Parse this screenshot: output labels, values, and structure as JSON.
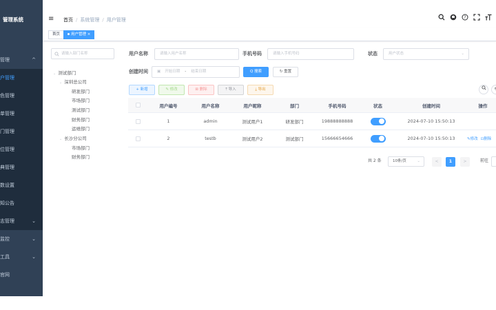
{
  "sidebar": {
    "logo": "管理系统",
    "items": [
      {
        "label": "管理",
        "chev": "^"
      },
      {
        "label": "户管理"
      },
      {
        "label": "色管理"
      },
      {
        "label": "单管理"
      },
      {
        "label": "门管理"
      },
      {
        "label": "位管理"
      },
      {
        "label": "典管理"
      },
      {
        "label": "数设置"
      },
      {
        "label": "知公告"
      },
      {
        "label": "志管理",
        "chev": "⌄"
      },
      {
        "label": "监控",
        "chev": "⌄"
      },
      {
        "label": "工具",
        "chev": "⌄"
      },
      {
        "label": "官网"
      }
    ]
  },
  "navbar": {
    "breadcrumb": [
      "首页",
      "系统管理",
      "用户管理"
    ],
    "icons": [
      "search-icon",
      "github-icon",
      "help-icon",
      "fullscreen-icon",
      "font-size-icon"
    ]
  },
  "tags": {
    "items": [
      {
        "label": "首页"
      },
      {
        "label": "用户管理 ×"
      }
    ]
  },
  "dept_tree": {
    "search_placeholder": "请输入部门名称",
    "nodes": [
      {
        "label": "测试部门",
        "arrow": "⌄"
      },
      {
        "label": "深圳总公司",
        "arrow": "⌄"
      },
      {
        "label": "研发部门"
      },
      {
        "label": "市场部门"
      },
      {
        "label": "测试部门"
      },
      {
        "label": "财务部门"
      },
      {
        "label": "运维部门"
      },
      {
        "label": "长沙分公司",
        "arrow": "⌄"
      },
      {
        "label": "市场部门"
      },
      {
        "label": "财务部门"
      }
    ]
  },
  "form": {
    "username_label": "用户名称",
    "username_placeholder": "请输入用户名称",
    "phone_label": "手机号码",
    "phone_placeholder": "请输入手机号码",
    "status_label": "状态",
    "status_placeholder": "用户状态",
    "created_label": "创建时间",
    "start_placeholder": "开始日期",
    "date_separator": "-",
    "end_placeholder": "结束日期",
    "search_btn": "Q 搜索",
    "reset_btn": "↻ 重置"
  },
  "toolbar": {
    "add": "+ 新增",
    "edit": "✎ 修改",
    "delete": "⊠ 删除",
    "import": "⤒ 导入",
    "export": "⤓ 导出"
  },
  "table": {
    "columns": [
      "用户编号",
      "用户名称",
      "用户昵称",
      "部门",
      "手机号码",
      "状态",
      "创建时间",
      "操作"
    ],
    "rows": [
      {
        "id": "1",
        "username": "admin",
        "nickname": "测试用户1",
        "dept": "研发部门",
        "phone": "19888888888",
        "status": "on",
        "created": "2024-07-10 15:50:13",
        "ops": [
          "✎修改"
        ]
      },
      {
        "id": "2",
        "username": "testb",
        "nickname": "测试用户2",
        "dept": "测试部门",
        "phone": "15666654666",
        "status": "on",
        "created": "2024-07-10 15:50:13",
        "ops": [
          "✎修改",
          "⊡删除"
        ]
      }
    ]
  },
  "pagination": {
    "total": "共 2 条",
    "page_size": "10条/页",
    "prev": "<",
    "current": "1",
    "next": ">",
    "goto": "前往"
  },
  "colors": {
    "accent": "#409eff",
    "sidebar": "#304156"
  }
}
